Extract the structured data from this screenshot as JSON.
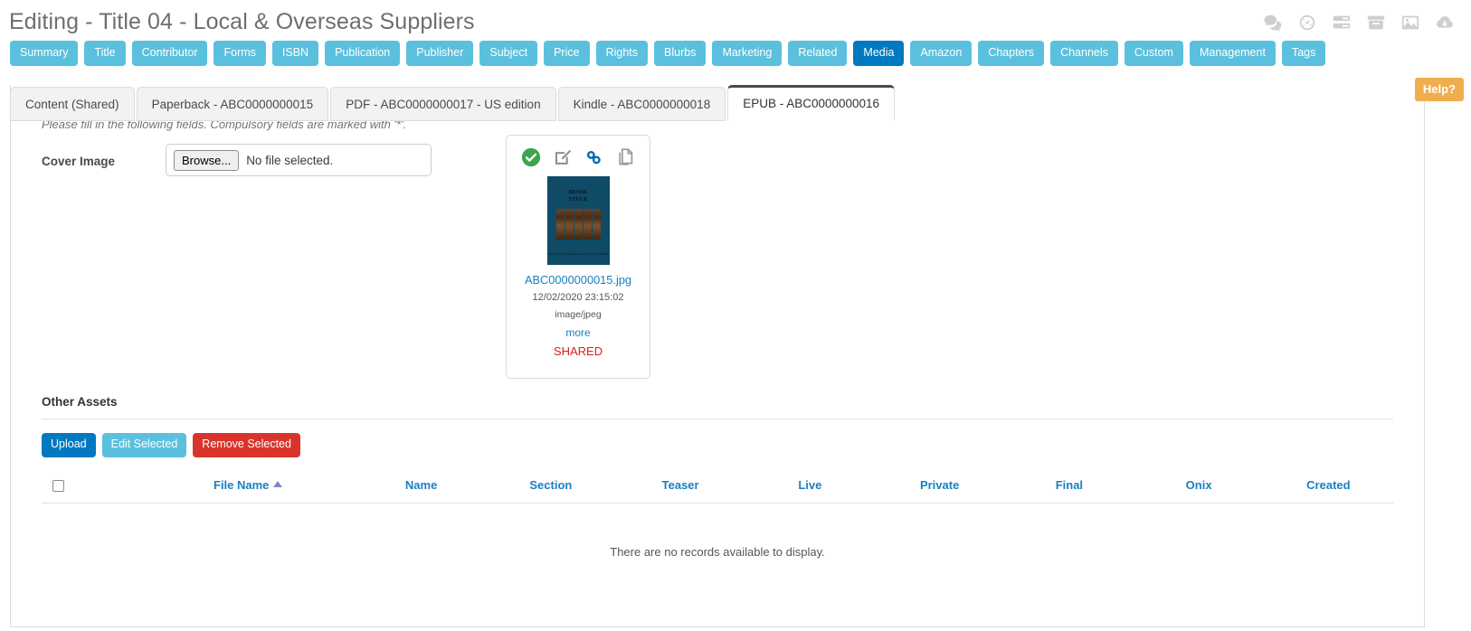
{
  "header": {
    "title": "Editing - Title 04 - Local & Overseas Suppliers",
    "icons": [
      {
        "name": "comments-icon",
        "label": "Comments"
      },
      {
        "name": "dashboard-gauge-icon",
        "label": "Dashboard"
      },
      {
        "name": "list-icon",
        "label": "List"
      },
      {
        "name": "archive-box-icon",
        "label": "Archive"
      },
      {
        "name": "image-icon",
        "label": "Images"
      },
      {
        "name": "cloud-download-icon",
        "label": "Download"
      }
    ]
  },
  "main_nav": {
    "items": [
      {
        "label": "Summary",
        "active": false
      },
      {
        "label": "Title",
        "active": false
      },
      {
        "label": "Contributor",
        "active": false
      },
      {
        "label": "Forms",
        "active": false
      },
      {
        "label": "ISBN",
        "active": false
      },
      {
        "label": "Publication",
        "active": false
      },
      {
        "label": "Publisher",
        "active": false
      },
      {
        "label": "Subject",
        "active": false
      },
      {
        "label": "Price",
        "active": false
      },
      {
        "label": "Rights",
        "active": false
      },
      {
        "label": "Blurbs",
        "active": false
      },
      {
        "label": "Marketing",
        "active": false
      },
      {
        "label": "Related",
        "active": false
      },
      {
        "label": "Media",
        "active": true
      },
      {
        "label": "Amazon",
        "active": false
      },
      {
        "label": "Chapters",
        "active": false
      },
      {
        "label": "Channels",
        "active": false
      },
      {
        "label": "Custom",
        "active": false
      },
      {
        "label": "Management",
        "active": false
      },
      {
        "label": "Tags",
        "active": false
      }
    ]
  },
  "help_button": {
    "label": "Help?"
  },
  "sub_tabs": {
    "items": [
      {
        "label": "Content (Shared)",
        "active": false
      },
      {
        "label": "Paperback - ABC0000000015",
        "active": false
      },
      {
        "label": "PDF - ABC0000000017 - US edition",
        "active": false
      },
      {
        "label": "Kindle - ABC0000000018",
        "active": false
      },
      {
        "label": "EPUB - ABC0000000016",
        "active": true
      }
    ]
  },
  "content": {
    "instructions": "Please fill in the following fields. Compulsory fields are marked with '*'.",
    "cover_image": {
      "label": "Cover Image",
      "browse_label": "Browse...",
      "no_file_text": "No file selected."
    },
    "asset_card": {
      "icons": [
        {
          "name": "approved-check-icon"
        },
        {
          "name": "edit-pencil-icon"
        },
        {
          "name": "link-chain-icon"
        },
        {
          "name": "duplicate-copy-icon"
        }
      ],
      "thumbnail": {
        "title_line1": "BOOK",
        "title_line2": "TITLE",
        "subtitle": "WITH THE AUTHOR\nAND SUBTITLE HERE"
      },
      "filename": "ABC0000000015.jpg",
      "timestamp": "12/02/2020 23:15:02",
      "mime_type": "image/jpeg",
      "more_label": "more",
      "shared_label": "SHARED"
    },
    "other_assets": {
      "title": "Other Assets",
      "buttons": [
        {
          "label": "Upload",
          "style": "primary"
        },
        {
          "label": "Edit Selected",
          "style": "info"
        },
        {
          "label": "Remove Selected",
          "style": "danger"
        }
      ],
      "table": {
        "columns": [
          {
            "label": "",
            "key": "checkbox"
          },
          {
            "label": "File Name",
            "key": "file_name",
            "sort": "asc"
          },
          {
            "label": "Name",
            "key": "name"
          },
          {
            "label": "Section",
            "key": "section"
          },
          {
            "label": "Teaser",
            "key": "teaser"
          },
          {
            "label": "Live",
            "key": "live"
          },
          {
            "label": "Private",
            "key": "private"
          },
          {
            "label": "Final",
            "key": "final"
          },
          {
            "label": "Onix",
            "key": "onix"
          },
          {
            "label": "Created",
            "key": "created"
          }
        ],
        "rows": [],
        "empty_message": "There are no records available to display."
      }
    }
  },
  "colors": {
    "nav_pill": "#5bc0de",
    "nav_pill_active": "#0079c1",
    "link": "#1a7fc1",
    "danger": "#d9342b",
    "help": "#f0ad4e",
    "shared": "#e01b1b",
    "title_text": "#6d6e70"
  }
}
